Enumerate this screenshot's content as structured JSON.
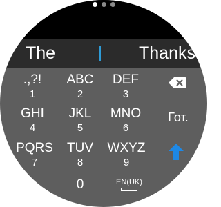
{
  "suggestions": {
    "left": "The",
    "right": "Thanks"
  },
  "keys": [
    {
      "main": ".,?!",
      "sub": "1"
    },
    {
      "main": "ABC",
      "sub": "2"
    },
    {
      "main": "DEF",
      "sub": "3"
    },
    {
      "main": "GHI",
      "sub": "4"
    },
    {
      "main": "JKL",
      "sub": "5"
    },
    {
      "main": "MNO",
      "sub": "6"
    },
    {
      "main": "PQRS",
      "sub": "7"
    },
    {
      "main": "TUV",
      "sub": "8"
    },
    {
      "main": "WXYZ",
      "sub": "9"
    }
  ],
  "space_key": "0",
  "language_key": "EN(UK)",
  "done_key": "Гот.",
  "icons": {
    "backspace": "backspace-icon",
    "shift": "shift-arrow-up-icon"
  },
  "pager": {
    "count": 3,
    "active": 1
  },
  "colors": {
    "cursor": "#2e9bd6",
    "shift": "#1e88e5",
    "keyboard": "#5e5e5e",
    "suggestion_bar": "#2b2b2b"
  }
}
